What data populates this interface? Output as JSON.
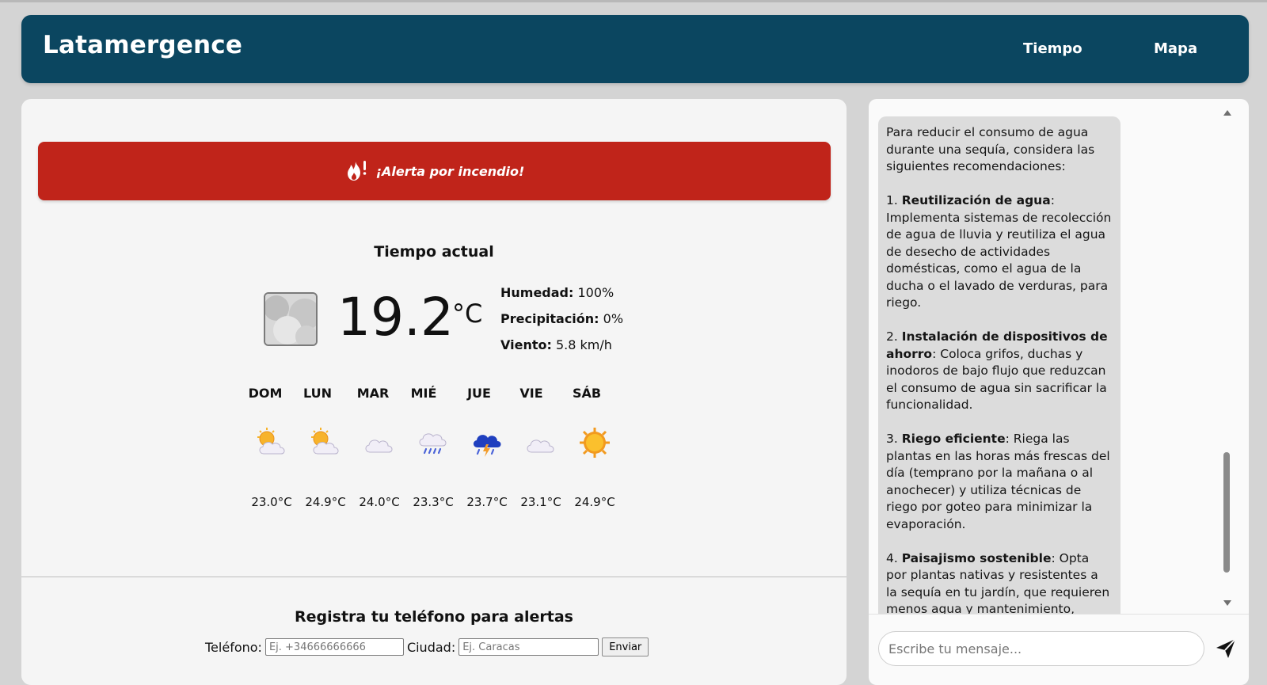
{
  "header": {
    "brand": "Latamergence",
    "nav": {
      "tiempo": "Tiempo",
      "mapa": "Mapa"
    }
  },
  "alert": {
    "text": "¡Alerta por incendio!",
    "icon": "fire-alert-icon",
    "color": "#c0241a"
  },
  "current": {
    "title": "Tiempo actual",
    "temperature": "19.2",
    "unit": "°C",
    "icon": "cloudy-icon",
    "stats": [
      {
        "label": "Humedad:",
        "value": "100%"
      },
      {
        "label": "Precipitación:",
        "value": "0%"
      },
      {
        "label": "Viento:",
        "value": "5.8 km/h"
      }
    ]
  },
  "forecast": [
    {
      "day": "DOM",
      "temp": "23.0°C",
      "icon": "partly-cloudy-icon"
    },
    {
      "day": "LUN",
      "temp": "24.9°C",
      "icon": "partly-cloudy-icon"
    },
    {
      "day": "MAR",
      "temp": "24.0°C",
      "icon": "cloud-icon"
    },
    {
      "day": "MIÉ",
      "temp": "23.3°C",
      "icon": "rain-icon"
    },
    {
      "day": "JUE",
      "temp": "23.7°C",
      "icon": "thunderstorm-icon"
    },
    {
      "day": "VIE",
      "temp": "23.1°C",
      "icon": "cloud-icon"
    },
    {
      "day": "SÁB",
      "temp": "24.9°C",
      "icon": "sun-icon"
    }
  ],
  "register": {
    "title": "Registra tu teléfono para alertas",
    "phone_label": "Teléfono:",
    "phone_placeholder": "Ej. +34666666666",
    "city_label": "Ciudad:",
    "city_placeholder": "Ej. Caracas",
    "submit": "Enviar"
  },
  "chat": {
    "intro": "Para reducir el consumo de agua durante una sequía, considera las siguientes recomendaciones:",
    "items": [
      {
        "num": "1.",
        "title": "Reutilización de agua",
        "text": ": Implementa sistemas de recolección de agua de lluvia y reutiliza el agua de desecho de actividades domésticas, como el agua de la ducha o el lavado de verduras, para riego."
      },
      {
        "num": "2.",
        "title": "Instalación de dispositivos de ahorro",
        "text": ": Coloca grifos, duchas y inodoros de bajo flujo que reduzcan el consumo de agua sin sacrificar la funcionalidad."
      },
      {
        "num": "3.",
        "title": "Riego eficiente",
        "text": ": Riega las plantas en las horas más frescas del día (temprano por la mañana o al anochecer) y utiliza técnicas de riego por goteo para minimizar la evaporación."
      },
      {
        "num": "4.",
        "title": "Paisajismo sostenible",
        "text": ": Opta por plantas nativas y resistentes a la sequía en tu jardín, que requieren menos agua y mantenimiento, contribuyendo a la conservación del"
      }
    ],
    "input_placeholder": "Escribe tu mensaje..."
  },
  "colors": {
    "header_bg": "#0b4660",
    "alert_bg": "#c0241a",
    "bubble_bg": "#dcdcdc"
  }
}
